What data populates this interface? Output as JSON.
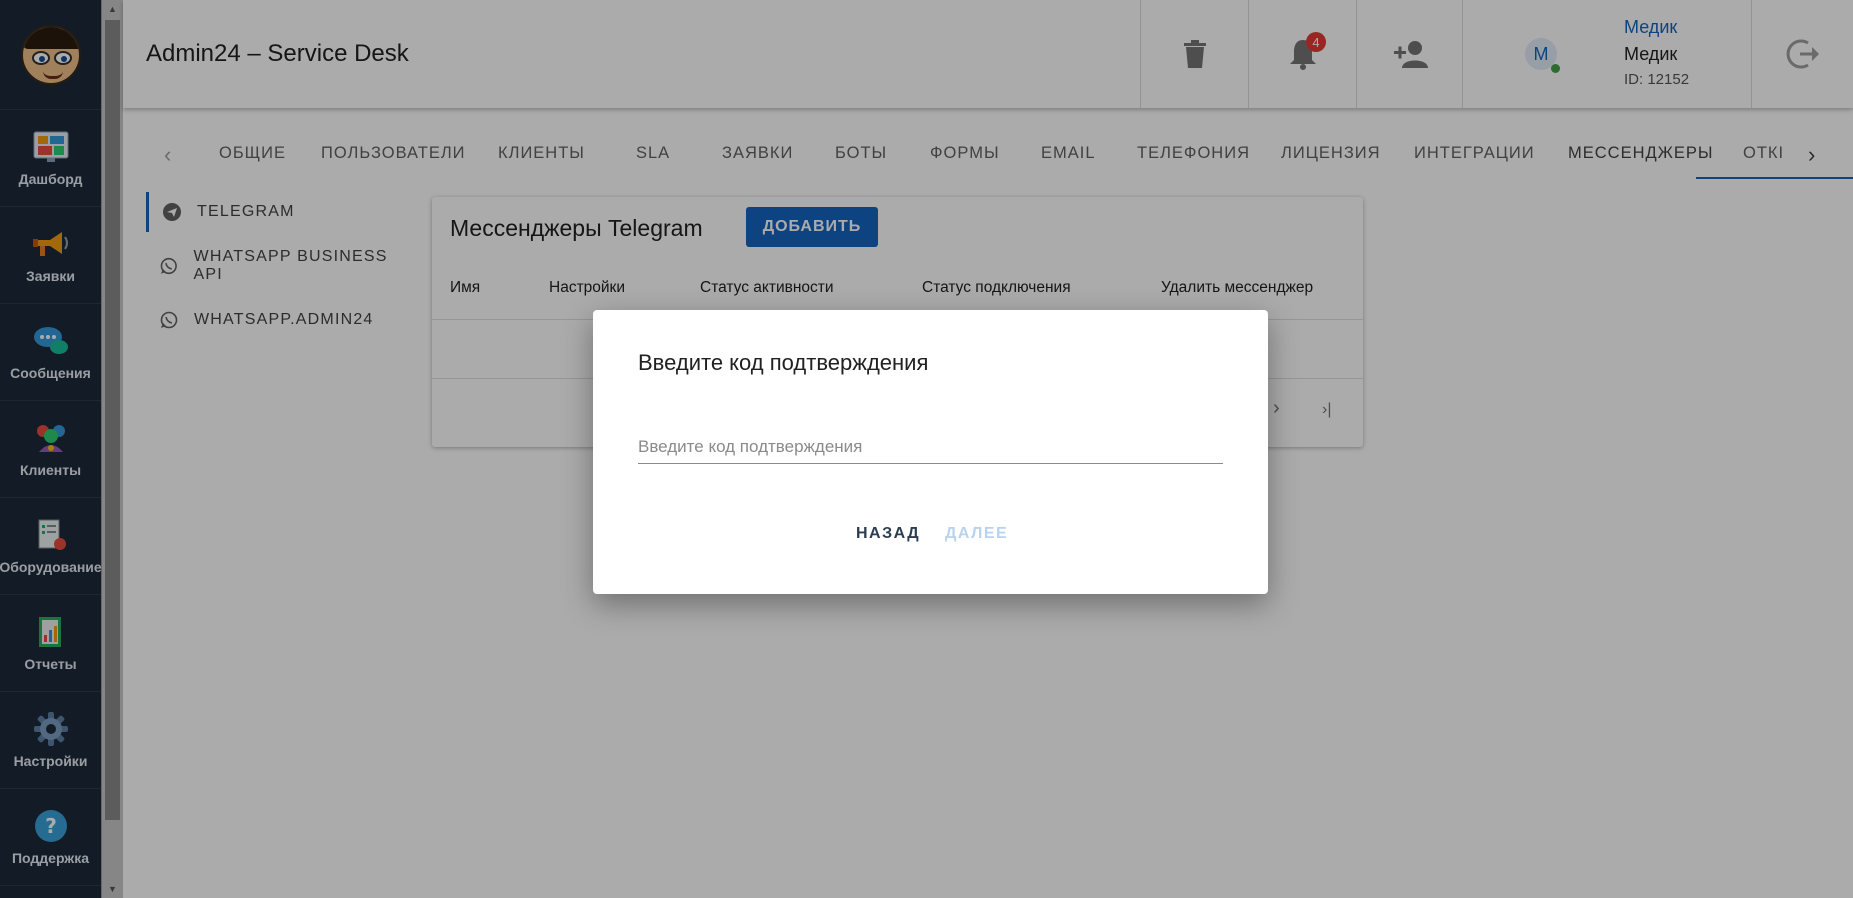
{
  "app": {
    "title": "Admin24 – Service Desk"
  },
  "sidebar": {
    "items": [
      {
        "label": "Дашборд",
        "icon": "dashboard-icon"
      },
      {
        "label": "Заявки",
        "icon": "megaphone-icon"
      },
      {
        "label": "Сообщения",
        "icon": "chat-icon"
      },
      {
        "label": "Клиенты",
        "icon": "clients-icon"
      },
      {
        "label": "Оборудование",
        "icon": "equipment-icon"
      },
      {
        "label": "Отчеты",
        "icon": "reports-icon"
      },
      {
        "label": "Настройки",
        "icon": "gear-icon"
      },
      {
        "label": "Поддержка",
        "icon": "help-icon"
      }
    ]
  },
  "header": {
    "notifications_count": "4",
    "user": {
      "link_name": "Медик",
      "name": "Медик",
      "id_text": "ID: 12152",
      "avatar_letter": "M"
    }
  },
  "tabs": [
    "ОБЩИЕ",
    "ПОЛЬЗОВАТЕЛИ",
    "КЛИЕНТЫ",
    "SLA",
    "ЗАЯВКИ",
    "БОТЫ",
    "ФОРМЫ",
    "EMAIL",
    "ТЕЛЕФОНИЯ",
    "ЛИЦЕНЗИЯ",
    "ИНТЕГРАЦИИ",
    "МЕССЕНДЖЕРЫ",
    "ОТКІ"
  ],
  "active_tab": "МЕССЕНДЖЕРЫ",
  "submenu": [
    {
      "label": "TELEGRAM",
      "icon": "telegram-icon"
    },
    {
      "label": "WHATSAPP BUSINESS API",
      "icon": "whatsapp-icon"
    },
    {
      "label": "WHATSAPP.ADMIN24",
      "icon": "whatsapp-icon"
    }
  ],
  "card": {
    "title": "Мессенджеры Telegram",
    "add_label": "ДОБАВИТЬ",
    "columns": [
      "Имя",
      "Настройки",
      "Статус активности",
      "Статус подключения",
      "Удалить мессенджер"
    ]
  },
  "dialog": {
    "title": "Введите код подтверждения",
    "input_placeholder": "Введите код подтверждения",
    "input_value": "",
    "back_label": "НАЗАД",
    "next_label": "ДАЛЕЕ"
  },
  "colors": {
    "accent": "#1565c0",
    "sidebar_bg": "#1d2a3a",
    "badge": "#e53935",
    "online": "#43a047"
  }
}
